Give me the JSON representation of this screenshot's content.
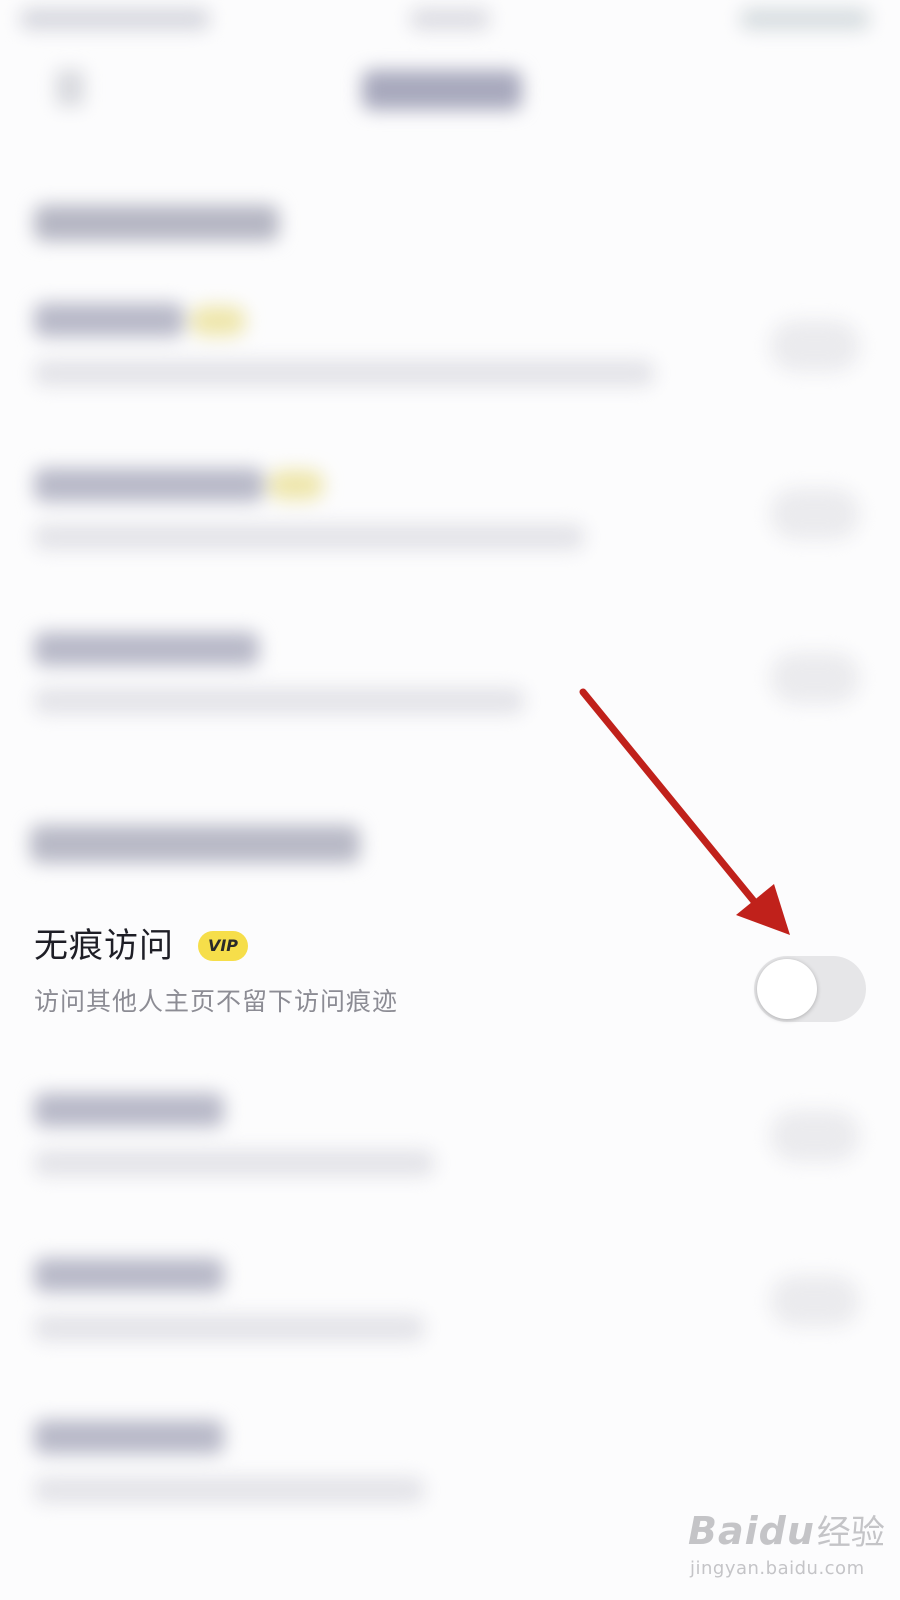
{
  "privacy_row": {
    "title": "无痕访问",
    "badge": "VIP",
    "description": "访问其他人主页不留下访问痕迹",
    "toggle_on": false
  },
  "annotation": {
    "arrow_color": "#c0211b"
  },
  "watermark": {
    "logo": "Bai",
    "logo_suffix": "du",
    "brand_cn": "经验",
    "url": "jingyan.baidu.com"
  },
  "colors": {
    "vip_badge": "#f6de4a",
    "toggle_off_track": "#e6e6e8",
    "title_text": "#1e1e26",
    "subtitle_text": "#8c8c94"
  }
}
